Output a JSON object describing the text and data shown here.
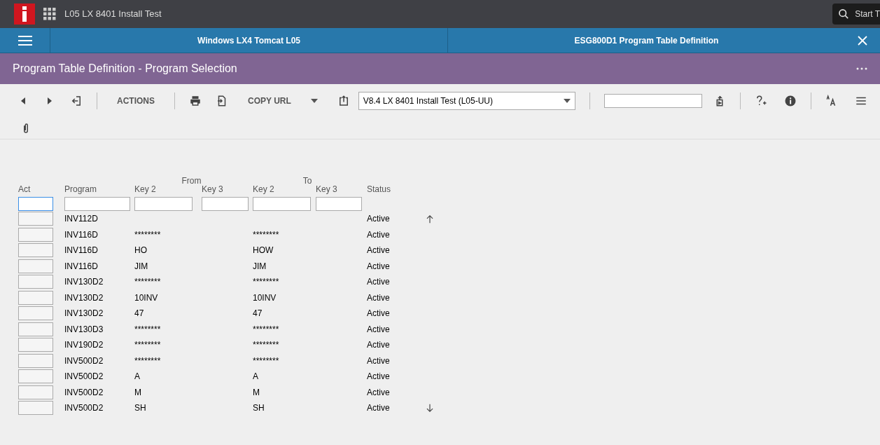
{
  "top_bar": {
    "app_title": "L05 LX 8401 Install Test",
    "search_label": "Start T"
  },
  "tabs": [
    "Windows LX4 Tomcat L05",
    "ESG800D1 Program Table Definition"
  ],
  "page_title": "Program Table Definition - Program Selection",
  "toolbar": {
    "actions_label": "ACTIONS",
    "copy_url_label": "COPY URL",
    "environment": "V8.4 LX 8401 Install Test (L05-UU)"
  },
  "table": {
    "group_headers": [
      "From",
      "To"
    ],
    "columns": [
      "Act",
      "Program",
      "Key 2",
      "Key 3",
      "Key 2",
      "Key 3",
      "Status"
    ],
    "filters": [
      {
        "focused": true
      },
      {
        "focused": false
      },
      {
        "focused": false
      },
      {
        "focused": false
      },
      {
        "focused": false
      },
      {
        "focused": false
      }
    ],
    "rows": [
      {
        "program": "INV112D",
        "status": "Active"
      },
      {
        "program": "INV116D",
        "from_key2": "********",
        "to_key2": "********",
        "status": "Active"
      },
      {
        "program": "INV116D",
        "from_key2": "HO",
        "to_key2": "HOW",
        "status": "Active"
      },
      {
        "program": "INV116D",
        "from_key2": "JIM",
        "to_key2": "JIM",
        "status": "Active"
      },
      {
        "program": "INV130D2",
        "from_key2": "********",
        "to_key2": "********",
        "status": "Active"
      },
      {
        "program": "INV130D2",
        "from_key2": "10INV",
        "to_key2": "10INV",
        "status": "Active"
      },
      {
        "program": "INV130D2",
        "from_key2": "47",
        "to_key2": "47",
        "status": "Active"
      },
      {
        "program": "INV130D3",
        "from_key2": "********",
        "to_key2": "********",
        "status": "Active"
      },
      {
        "program": "INV190D2",
        "from_key2": "********",
        "to_key2": "********",
        "status": "Active"
      },
      {
        "program": "INV500D2",
        "from_key2": "********",
        "to_key2": "********",
        "status": "Active"
      },
      {
        "program": "INV500D2",
        "from_key2": "A",
        "to_key2": "A",
        "status": "Active"
      },
      {
        "program": "INV500D2",
        "from_key2": "M",
        "to_key2": "M",
        "status": "Active"
      },
      {
        "program": "INV500D2",
        "from_key2": "SH",
        "to_key2": "SH",
        "status": "Active"
      }
    ]
  }
}
